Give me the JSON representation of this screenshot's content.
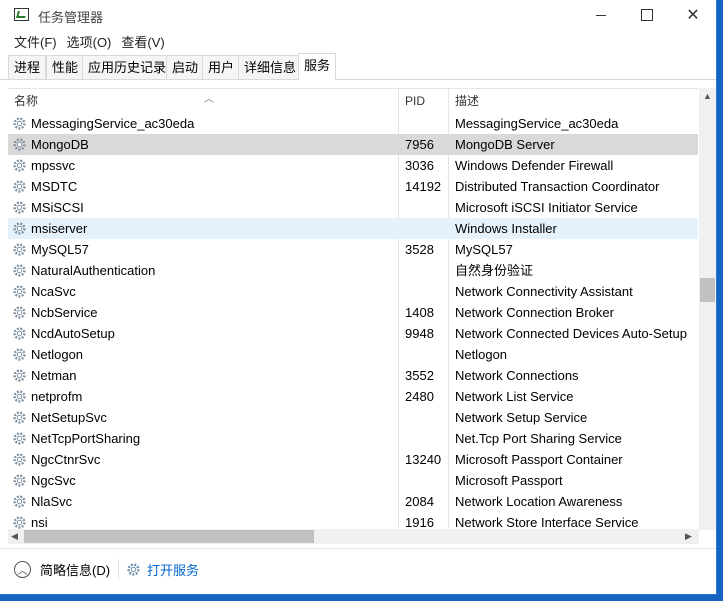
{
  "window": {
    "title": "任务管理器"
  },
  "menu": [
    "文件(F)",
    "选项(O)",
    "查看(V)"
  ],
  "tabs": [
    {
      "label": "进程"
    },
    {
      "label": "性能"
    },
    {
      "label": "应用历史记录"
    },
    {
      "label": "启动"
    },
    {
      "label": "用户"
    },
    {
      "label": "详细信息"
    },
    {
      "label": "服务",
      "active": true
    }
  ],
  "table": {
    "columns": {
      "name": "名称",
      "pid": "PID",
      "desc": "描述"
    },
    "rows": [
      {
        "name": "MessagingService_ac30eda",
        "pid": "",
        "desc": "MessagingService_ac30eda"
      },
      {
        "name": "MongoDB",
        "pid": "7956",
        "desc": "MongoDB Server",
        "state": "selected"
      },
      {
        "name": "mpssvc",
        "pid": "3036",
        "desc": "Windows Defender Firewall"
      },
      {
        "name": "MSDTC",
        "pid": "14192",
        "desc": "Distributed Transaction Coordinator"
      },
      {
        "name": "MSiSCSI",
        "pid": "",
        "desc": "Microsoft iSCSI Initiator Service"
      },
      {
        "name": "msiserver",
        "pid": "",
        "desc": "Windows Installer",
        "state": "hover"
      },
      {
        "name": "MySQL57",
        "pid": "3528",
        "desc": "MySQL57"
      },
      {
        "name": "NaturalAuthentication",
        "pid": "",
        "desc": "自然身份验证"
      },
      {
        "name": "NcaSvc",
        "pid": "",
        "desc": "Network Connectivity Assistant"
      },
      {
        "name": "NcbService",
        "pid": "1408",
        "desc": "Network Connection Broker"
      },
      {
        "name": "NcdAutoSetup",
        "pid": "9948",
        "desc": "Network Connected Devices Auto-Setup"
      },
      {
        "name": "Netlogon",
        "pid": "",
        "desc": "Netlogon"
      },
      {
        "name": "Netman",
        "pid": "3552",
        "desc": "Network Connections"
      },
      {
        "name": "netprofm",
        "pid": "2480",
        "desc": "Network List Service"
      },
      {
        "name": "NetSetupSvc",
        "pid": "",
        "desc": "Network Setup Service"
      },
      {
        "name": "NetTcpPortSharing",
        "pid": "",
        "desc": "Net.Tcp Port Sharing Service"
      },
      {
        "name": "NgcCtnrSvc",
        "pid": "13240",
        "desc": "Microsoft Passport Container"
      },
      {
        "name": "NgcSvc",
        "pid": "",
        "desc": "Microsoft Passport"
      },
      {
        "name": "NlaSvc",
        "pid": "2084",
        "desc": "Network Location Awareness"
      },
      {
        "name": "nsi",
        "pid": "1916",
        "desc": "Network Store Interface Service"
      }
    ]
  },
  "footer": {
    "less_details": "简略信息(D)",
    "open_services": "打开服务"
  },
  "colors": {
    "selected_row": "#d9d9d9",
    "hover_row": "#e5f1fb",
    "link": "#0066cc",
    "desktop": "#1565c0"
  },
  "icons": {
    "row_icon": "gear-icon"
  }
}
